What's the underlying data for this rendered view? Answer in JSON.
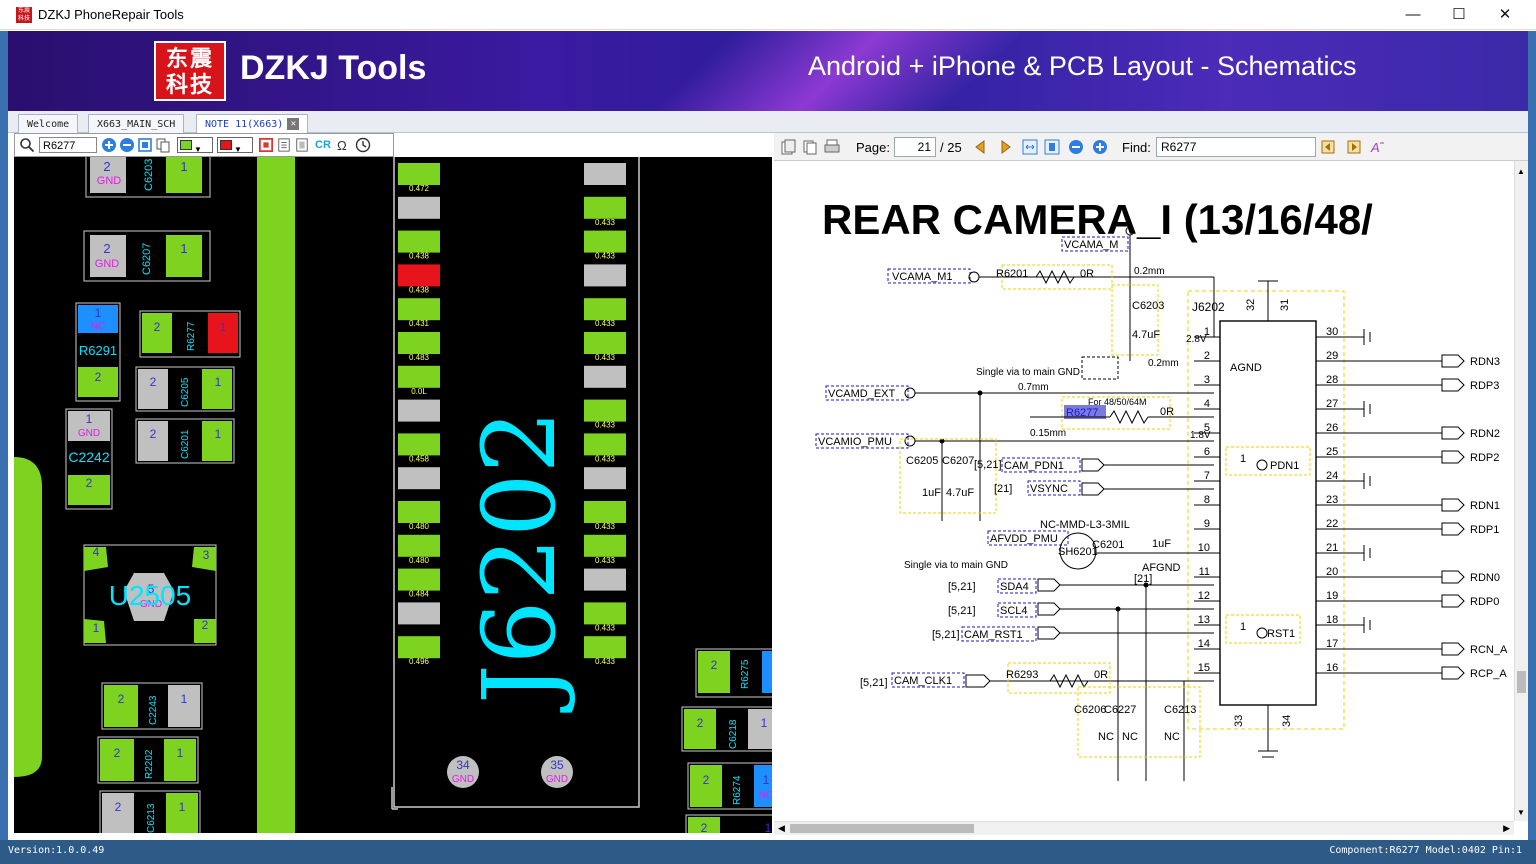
{
  "window": {
    "title": "DZKJ PhoneRepair Tools",
    "icon_text": "东震科技",
    "minimize": "—",
    "maximize": "☐",
    "close": "✕"
  },
  "banner": {
    "logo_text": "东震科技",
    "brand": "DZKJ Tools",
    "slogan": "Android + iPhone & PCB Layout - Schematics"
  },
  "tabs": [
    {
      "label": "Welcome",
      "active": false
    },
    {
      "label": "X663_MAIN_SCH",
      "active": false
    },
    {
      "label": "NOTE 11(X663)",
      "active": true
    }
  ],
  "left_toolbar": {
    "search_value": "R6277",
    "cr_label": "CR",
    "fill_color": "#7ed321",
    "highlight_color": "#e8141b"
  },
  "right_toolbar": {
    "page_label": "Page:",
    "page_current": "21",
    "page_total": "/ 25",
    "find_label": "Find:",
    "find_value": "R6277"
  },
  "pcb": {
    "components": [
      {
        "ref": "C6203",
        "pins": [
          "2",
          "1"
        ],
        "pin_label": "GND"
      },
      {
        "ref": "C6207",
        "pins": [
          "2",
          "1"
        ],
        "pin_label": "GND"
      },
      {
        "ref": "R6291",
        "pins": [
          "1",
          "2"
        ],
        "pin_label": "NC"
      },
      {
        "ref": "R6277",
        "pins": [
          "2",
          "1"
        ]
      },
      {
        "ref": "C6205",
        "pins": [
          "2",
          "1"
        ]
      },
      {
        "ref": "C6201",
        "pins": [
          "2",
          "1"
        ]
      },
      {
        "ref": "C2242",
        "pins": [
          "1",
          "2"
        ],
        "pin_label": "GND"
      },
      {
        "ref": "U2505",
        "pins": [
          "4",
          "3",
          "5",
          "1",
          "2"
        ],
        "pin_label": "GND"
      },
      {
        "ref": "C2243",
        "pins": [
          "2",
          "1"
        ]
      },
      {
        "ref": "R2202",
        "pins": [
          "2",
          "1"
        ]
      },
      {
        "ref": "C6213",
        "pins": [
          "2",
          "1"
        ]
      },
      {
        "ref": "R6275",
        "pins": [
          "2"
        ]
      },
      {
        "ref": "C6218",
        "pins": [
          "2",
          "1"
        ]
      },
      {
        "ref": "R6274",
        "pins": [
          "2",
          "1"
        ],
        "pin_label": "NC"
      },
      {
        "ref": "J6202",
        "pins": [
          "34",
          "35"
        ],
        "pin_label": "GND"
      }
    ],
    "connector_left_values": [
      "0.472",
      "",
      "0.438",
      "0.438",
      "0.431",
      "0.483",
      "0.0L",
      "",
      "0.458",
      "",
      "0.480",
      "0.480",
      "0.484",
      "",
      "0.496"
    ],
    "connector_right_values": [
      "",
      "0.433",
      "0.433",
      "",
      "0.433",
      "0.433",
      "",
      "0.433",
      "0.433",
      "",
      "0.433",
      "0.433",
      "",
      "0.433",
      "0.433"
    ],
    "extra_pin": "1"
  },
  "schematic": {
    "title": "REAR CAMERA_I (13/16/48/",
    "connector": "J6202",
    "agnd": "AGND",
    "nets_left": [
      "VCAMA_M1",
      "VCAMA_M",
      "VCAMD_EXT",
      "VCAMIO_PMU",
      "CAM_PDN1",
      "VSYNC",
      "AFVDD_PMU",
      "SDA4",
      "SCL4",
      "CAM_RST1",
      "CAM_CLK1"
    ],
    "refs": [
      "R6201",
      "C6203",
      "R6277",
      "C6205",
      "C6207",
      "C6201",
      "SH6201",
      "R6293",
      "C6206",
      "C6227",
      "C6213"
    ],
    "values": [
      "0R",
      "4.7uF",
      "0R",
      "1uF",
      "4.7uF",
      "1uF",
      "0R",
      "NC",
      "NC",
      "NC"
    ],
    "notes": [
      "0.2mm",
      "0.2mm",
      "0.7mm",
      "0.15mm",
      "2.8V",
      "1.8V",
      "Single via to main GND",
      "Single via to main GND",
      "For 48/50/64M",
      "NC-MMD-L3-3MIL",
      "[5,21]",
      "[21]",
      "[5,21]",
      "[5,21]",
      "[5,21]",
      "[21]",
      "[5,21]",
      "AFGND",
      "PDN1",
      "RST1"
    ],
    "pins_left": [
      "1",
      "2",
      "3",
      "4",
      "5",
      "6",
      "7",
      "8",
      "9",
      "10",
      "11",
      "12",
      "13",
      "14",
      "15"
    ],
    "pins_right": [
      "30",
      "29",
      "28",
      "27",
      "26",
      "25",
      "24",
      "23",
      "22",
      "21",
      "20",
      "19",
      "18",
      "17",
      "16"
    ],
    "pins_top": [
      "32",
      "31"
    ],
    "pins_bottom": [
      "33",
      "34"
    ],
    "nets_right": [
      "RDN3",
      "RDP3",
      "RDN2",
      "RDP2",
      "RDN1",
      "RDP1",
      "RDN0",
      "RDP0",
      "RCN_A",
      "RCP_A"
    ]
  },
  "status": {
    "version": "Version:1.0.0.49",
    "component": "Component:R6277 Model:0402 Pin:1"
  },
  "colors": {
    "pad_green": "#7ed321",
    "pad_gray": "#c0c0c0",
    "pad_red": "#e8141b",
    "pad_blue": "#1e8fff",
    "label_cyan": "#00e5ff",
    "net_blue": "#1a1acc",
    "dash_yellow": "#f2d200"
  }
}
